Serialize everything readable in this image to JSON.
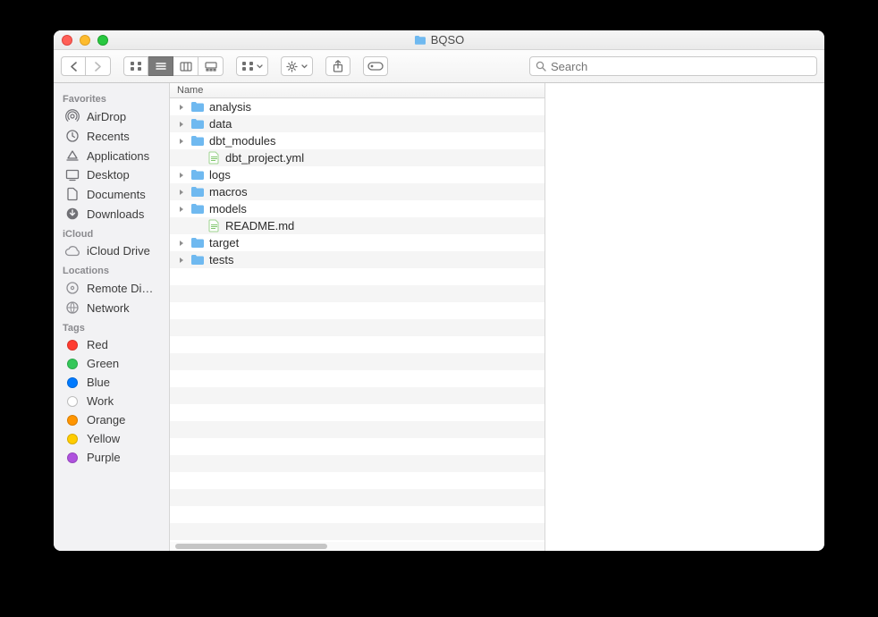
{
  "window": {
    "title": "BQSO"
  },
  "toolbar": {
    "search_placeholder": "Search"
  },
  "sidebar": {
    "sections": [
      {
        "header": "Favorites",
        "items": [
          {
            "label": "AirDrop"
          },
          {
            "label": "Recents"
          },
          {
            "label": "Applications"
          },
          {
            "label": "Desktop"
          },
          {
            "label": "Documents"
          },
          {
            "label": "Downloads"
          }
        ]
      },
      {
        "header": "iCloud",
        "items": [
          {
            "label": "iCloud Drive"
          }
        ]
      },
      {
        "header": "Locations",
        "items": [
          {
            "label": "Remote Di…"
          },
          {
            "label": "Network"
          }
        ]
      },
      {
        "header": "Tags",
        "items": [
          {
            "label": "Red",
            "color": "#ff3b30"
          },
          {
            "label": "Green",
            "color": "#34c759"
          },
          {
            "label": "Blue",
            "color": "#007aff"
          },
          {
            "label": "Work",
            "color": "#ffffff",
            "border": "#bdbdbd"
          },
          {
            "label": "Orange",
            "color": "#ff9500"
          },
          {
            "label": "Yellow",
            "color": "#ffcc00"
          },
          {
            "label": "Purple",
            "color": "#af52de"
          }
        ]
      }
    ]
  },
  "list": {
    "column_header": "Name",
    "items": [
      {
        "name": "analysis",
        "type": "folder"
      },
      {
        "name": "data",
        "type": "folder"
      },
      {
        "name": "dbt_modules",
        "type": "folder"
      },
      {
        "name": "dbt_project.yml",
        "type": "file"
      },
      {
        "name": "logs",
        "type": "folder"
      },
      {
        "name": "macros",
        "type": "folder"
      },
      {
        "name": "models",
        "type": "folder"
      },
      {
        "name": "README.md",
        "type": "file"
      },
      {
        "name": "target",
        "type": "folder"
      },
      {
        "name": "tests",
        "type": "folder"
      }
    ]
  }
}
